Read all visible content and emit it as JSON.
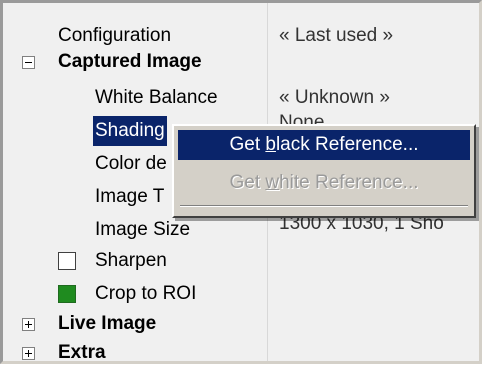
{
  "tree": {
    "configuration": {
      "label": "Configuration",
      "value": "« Last used »"
    },
    "captured_image": {
      "label": "Captured Image"
    },
    "white_balance": {
      "label": "White Balance",
      "value": "« Unknown »"
    },
    "shading": {
      "label": "Shading",
      "value": "None"
    },
    "color_depth": {
      "label": "Color de"
    },
    "image_type": {
      "label": "Image T"
    },
    "image_size": {
      "label": "Image Size",
      "value": "1300 x 1030, 1 Sho"
    },
    "sharpen": {
      "label": "Sharpen",
      "checked": false
    },
    "crop_to_roi": {
      "label": "Crop to ROI",
      "checked": true
    },
    "live_image": {
      "label": "Live Image"
    },
    "extra": {
      "label": "Extra"
    }
  },
  "context_menu": {
    "items": [
      {
        "pre": "Get ",
        "accel": "b",
        "post": "lack Reference...",
        "enabled": true
      },
      {
        "pre": "Get ",
        "accel": "w",
        "post": "hite Reference...",
        "enabled": false
      }
    ]
  },
  "colors": {
    "selection": "#0a246a",
    "menu_bg": "#d4d0c8",
    "crop_checkbox": "#1f8b1f"
  }
}
